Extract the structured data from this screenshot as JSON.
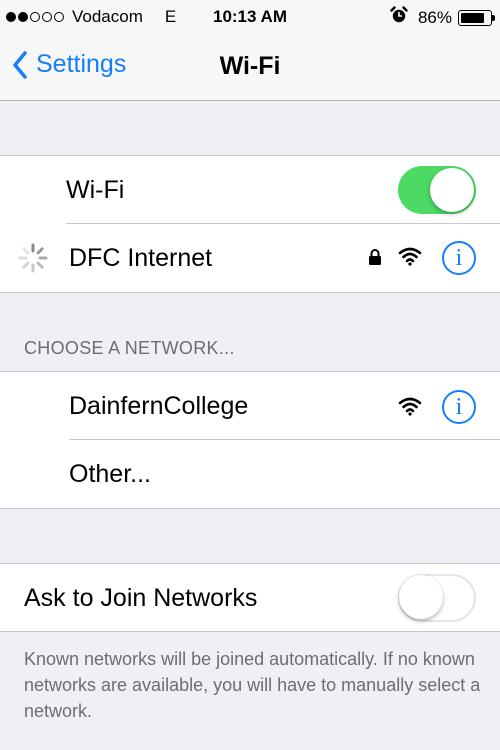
{
  "status_bar": {
    "carrier": "Vodacom",
    "network_type": "E",
    "time": "10:13 AM",
    "battery_percent": "86%",
    "battery_level": 0.86,
    "signal_bars_filled": 2,
    "signal_bars_total": 5,
    "alarm_icon": "alarm-clock-icon"
  },
  "nav": {
    "back_label": "Settings",
    "title": "Wi-Fi"
  },
  "wifi": {
    "label": "Wi-Fi",
    "enabled": true,
    "connected_network": {
      "name": "DFC Internet",
      "secured": true,
      "status": "connecting"
    }
  },
  "choose_network": {
    "header": "CHOOSE A NETWORK...",
    "networks": [
      {
        "name": "DainfernCollege",
        "secured": false
      }
    ],
    "other_label": "Other..."
  },
  "ask_to_join": {
    "label": "Ask to Join Networks",
    "enabled": false,
    "footer": "Known networks will be joined automatically. If no known networks are available, you will have to manually select a network."
  },
  "colors": {
    "accent": "#157efb",
    "toggle_on": "#4cd964",
    "background": "#efeff4",
    "secondary_text": "#6d6d72"
  }
}
